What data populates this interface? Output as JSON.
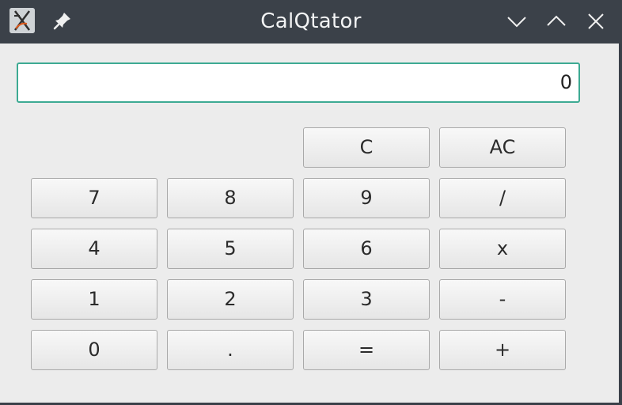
{
  "window": {
    "title": "CalQtator",
    "icons": {
      "app": "qt-calculator-app-icon",
      "pin": "pin-icon",
      "minimize": "chevron-down-icon",
      "maximize": "chevron-up-icon",
      "close": "close-icon"
    }
  },
  "display": {
    "value": "0"
  },
  "keys": {
    "clear": "C",
    "all_clear": "AC",
    "seven": "7",
    "eight": "8",
    "nine": "9",
    "divide": "/",
    "four": "4",
    "five": "5",
    "six": "6",
    "multiply": "x",
    "one": "1",
    "two": "2",
    "three": "3",
    "subtract": "-",
    "zero": "0",
    "decimal": ".",
    "equals": "=",
    "add": "+"
  },
  "colors": {
    "titlebar": "#3b4149",
    "accent_focus": "#3daa93",
    "window_bg": "#ececec"
  }
}
